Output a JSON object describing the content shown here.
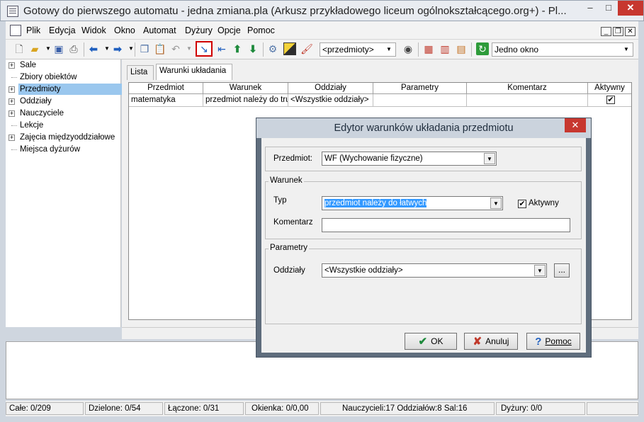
{
  "window": {
    "title": "Gotowy do pierwszego automatu - jedna zmiana.pla (Arkusz przykładowego liceum ogólnokształcącego.org+) - Pl...",
    "minimize": "–",
    "maximize": "□",
    "close": "✕"
  },
  "menu": [
    "Plik",
    "Edycja",
    "Widok",
    "Okno",
    "Automat",
    "Dyżury",
    "Opcje",
    "Pomoc"
  ],
  "mdi_controls": [
    "_",
    "❐",
    "✕"
  ],
  "toolbar": {
    "combo_value": "<przedmioty>",
    "window_combo": "Jedno okno"
  },
  "tree": [
    {
      "label": "Sale",
      "expandable": true,
      "selected": false
    },
    {
      "label": "Zbiory obiektów",
      "expandable": false,
      "selected": false
    },
    {
      "label": "Przedmioty",
      "expandable": true,
      "selected": true
    },
    {
      "label": "Oddziały",
      "expandable": true,
      "selected": false
    },
    {
      "label": "Nauczyciele",
      "expandable": true,
      "selected": false
    },
    {
      "label": "Lekcje",
      "expandable": false,
      "selected": false
    },
    {
      "label": "Zajęcia międzyoddziałowe",
      "expandable": true,
      "selected": false
    },
    {
      "label": "Miejsca dyżurów",
      "expandable": false,
      "selected": false
    }
  ],
  "tabs": [
    {
      "label": "Lista",
      "active": false
    },
    {
      "label": "Warunki układania",
      "active": true
    }
  ],
  "grid": {
    "columns": [
      "Przedmiot",
      "Warunek",
      "Oddziały",
      "Parametry",
      "Komentarz",
      "Aktywny"
    ],
    "rows": [
      {
        "przedmiot": "matematyka",
        "warunek": "przedmiot należy do trudnych",
        "oddzialy": "<Wszystkie oddziały>",
        "parametry": "",
        "komentarz": "",
        "aktywny": true
      }
    ]
  },
  "status": [
    "Całe: 0/209",
    "Dzielone: 0/54",
    "Łączone: 0/31",
    "Okienka: 0/0,00",
    "Nauczycieli:17  Oddziałów:8  Sal:16",
    "Dyżury: 0/0",
    ""
  ],
  "dialog": {
    "title": "Edytor warunków układania przedmiotu",
    "przedmiot_label": "Przedmiot:",
    "przedmiot_value": "WF (Wychowanie fizyczne)",
    "warunek_group": "Warunek",
    "typ_label": "Typ",
    "typ_value": "przedmiot należy do łatwych",
    "aktywny_label": "Aktywny",
    "aktywny_checked": true,
    "komentarz_label": "Komentarz",
    "komentarz_value": "",
    "parametry_group": "Parametry",
    "oddzialy_label": "Oddziały",
    "oddzialy_value": "<Wszystkie oddziały>",
    "ellipsis": "...",
    "ok": "OK",
    "cancel": "Anuluj",
    "help": "Pomoc"
  },
  "colors": {
    "accent": "#3399ff",
    "tree_selection": "#9ac7ee",
    "close_red": "#c7372f"
  }
}
